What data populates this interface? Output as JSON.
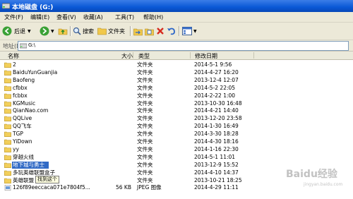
{
  "window": {
    "title": "本地磁盘 (G:)"
  },
  "menu": [
    "文件(F)",
    "编辑(E)",
    "查看(V)",
    "收藏(A)",
    "工具(T)",
    "帮助(H)"
  ],
  "toolbar": {
    "back": "后退",
    "search": "搜索",
    "folders": "文件夹"
  },
  "address": {
    "label": "地址(D)",
    "value": "G:\\"
  },
  "columns": {
    "name": "名称",
    "size": "大小",
    "type": "类型",
    "modified": "修改日期"
  },
  "rows": [
    {
      "name": "2",
      "size": "",
      "type": "文件夹",
      "modified": "2014-5-1 9:56"
    },
    {
      "name": "BaiduYunGuanjia",
      "size": "",
      "type": "文件夹",
      "modified": "2014-4-27 16:20"
    },
    {
      "name": "Baofeng",
      "size": "",
      "type": "文件夹",
      "modified": "2013-12-4 12:07"
    },
    {
      "name": "cfbbx",
      "size": "",
      "type": "文件夹",
      "modified": "2014-5-2 22:05"
    },
    {
      "name": "fcbbx",
      "size": "",
      "type": "文件夹",
      "modified": "2014-2-22 1:00"
    },
    {
      "name": "KGMusic",
      "size": "",
      "type": "文件夹",
      "modified": "2013-10-30 16:48"
    },
    {
      "name": "QianNao.com",
      "size": "",
      "type": "文件夹",
      "modified": "2014-4-21 14:40"
    },
    {
      "name": "QQLive",
      "size": "",
      "type": "文件夹",
      "modified": "2013-12-20 23:58"
    },
    {
      "name": "QQ飞车",
      "size": "",
      "type": "文件夹",
      "modified": "2014-1-30 16:49"
    },
    {
      "name": "TGP",
      "size": "",
      "type": "文件夹",
      "modified": "2014-3-30 18:28"
    },
    {
      "name": "YiDown",
      "size": "",
      "type": "文件夹",
      "modified": "2014-4-30 18:16"
    },
    {
      "name": "yy",
      "size": "",
      "type": "文件夹",
      "modified": "2014-1-16 22:30"
    },
    {
      "name": "穿越火线",
      "size": "",
      "type": "文件夹",
      "modified": "2014-5-1 11:01"
    },
    {
      "name": "地下城与勇士",
      "size": "",
      "type": "文件夹",
      "modified": "2013-12-9 15:52"
    },
    {
      "name": "多玩英雄联盟盒子",
      "size": "",
      "type": "文件夹",
      "modified": "2014-4-10 14:37"
    },
    {
      "name": "英雄联盟",
      "size": "",
      "type": "文件夹",
      "modified": "2013-10-21 18:25"
    },
    {
      "name": "126f89eeccaca071e7804f5...",
      "size": "56 KB",
      "type": "JPEG 图像",
      "modified": "2014-4-29 11:11"
    }
  ],
  "tooltip": "找到这个",
  "watermark": "Baidu经验",
  "watermark_url": "jingyan.baidu.com"
}
